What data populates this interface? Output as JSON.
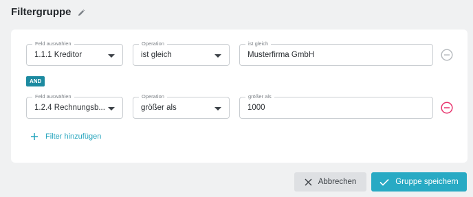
{
  "header": {
    "title": "Filtergruppe",
    "edit_icon": "pencil-icon"
  },
  "filters": [
    {
      "field_label": "Feld auswählen",
      "field_value": "1.1.1 Kreditor",
      "operation_label": "Operation",
      "operation_value": "ist gleich",
      "value_label": "ist gleich",
      "value": "Musterfirma GmbH",
      "remove_icon": "minus-circle-icon",
      "remove_color": "#b5b9bd"
    },
    {
      "field_label": "Feld auswählen",
      "field_value": "1.2.4 Rechnungsb...",
      "operation_label": "Operation",
      "operation_value": "größer als",
      "value_label": "größer als",
      "value": "1000",
      "remove_icon": "minus-circle-icon",
      "remove_color": "#e8336d"
    }
  ],
  "connector": "AND",
  "add_filter": {
    "label": "Filter hinzufügen",
    "icon": "plus-icon"
  },
  "footer": {
    "cancel_label": "Abbrechen",
    "cancel_icon": "close-icon",
    "save_label": "Gruppe speichern",
    "save_icon": "check-icon"
  },
  "colors": {
    "accent": "#28aac4",
    "badge": "#1c8aa0",
    "danger": "#e8336d",
    "background": "#f0f1f2"
  }
}
